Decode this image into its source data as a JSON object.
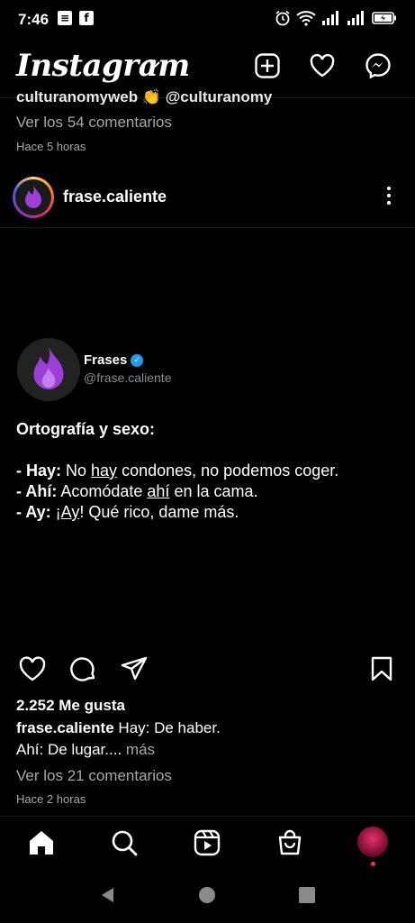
{
  "status": {
    "time": "7:46",
    "left_icons": [
      "message-icon",
      "facebook-icon"
    ],
    "right_icons": [
      "alarm-icon",
      "wifi-icon",
      "signal-icon",
      "signal-icon",
      "battery-icon"
    ]
  },
  "header": {
    "logo": "Instagram"
  },
  "prev_post": {
    "caption_partial": "culturanomyweb 👏 @culturanomy",
    "comments": "Ver los 54 comentarios",
    "time": "Hace 5 horas"
  },
  "post": {
    "username": "frase.caliente",
    "card": {
      "name": "Frases",
      "handle": "@frase.caliente",
      "title": "Ortografía y sexo:",
      "lines": [
        {
          "term": "- Hay:",
          "pre": " No ",
          "under": "hay",
          "post": " condones, no podemos coger."
        },
        {
          "term": "- Ahí:",
          "pre": " Acomódate ",
          "under": "ahí",
          "post": " en la cama."
        },
        {
          "term": "- Ay:",
          "pre": " ¡",
          "under": "Ay",
          "post": "! Qué rico, dame más."
        }
      ]
    },
    "likes": "2.252 Me gusta",
    "caption_user": "frase.caliente",
    "caption_text": " Hay: De haber.",
    "caption_line2": "Ahí: De lugar.",
    "caption_more_sep": "... ",
    "caption_more": "más",
    "comments": "Ver los 21 comentarios",
    "time": "Hace 2 horas"
  },
  "colors": {
    "background": "#000000",
    "secondary_text": "#a8a8a8",
    "verified": "#1d9bf0",
    "flame": "#9b3fd8"
  }
}
